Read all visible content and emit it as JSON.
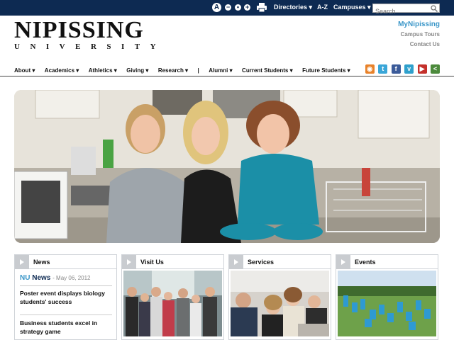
{
  "topbar": {
    "text_size_label": "A",
    "minus": "−",
    "dot": "•",
    "plus": "+",
    "nav": [
      "Directories ▾",
      "A-Z",
      "Campuses ▾"
    ],
    "search_placeholder": "Search"
  },
  "header": {
    "logo_main": "NIPISSING",
    "logo_sub": "UNIVERSITY",
    "right_links": {
      "primary": "MyNipissing",
      "secondary": [
        "Campus Tours",
        "Contact Us"
      ]
    }
  },
  "mainnav": {
    "items": [
      "About ▾",
      "Academics ▾",
      "Athletics ▾",
      "Giving ▾",
      "Research ▾",
      "|",
      "Alumni ▾",
      "Current Students ▾",
      "Future Students ▾"
    ]
  },
  "social": [
    {
      "icon": "rss-icon",
      "glyph": "◉",
      "color": "#e8822a"
    },
    {
      "icon": "twitter-icon",
      "glyph": "t",
      "color": "#3aa6d8"
    },
    {
      "icon": "facebook-icon",
      "glyph": "f",
      "color": "#3b5b99"
    },
    {
      "icon": "vimeo-icon",
      "glyph": "v",
      "color": "#2fa0cc"
    },
    {
      "icon": "youtube-icon",
      "glyph": "▶",
      "color": "#c4302b"
    },
    {
      "icon": "share-icon",
      "glyph": "<",
      "color": "#4c8a3c"
    }
  ],
  "boxes": {
    "news": {
      "title": "News",
      "brand_nu": "NU",
      "brand_news": "News",
      "date": "- May 06, 2012",
      "items": [
        "Poster event displays biology students' success",
        "Business students excel in strategy game"
      ]
    },
    "visit": {
      "title": "Visit Us"
    },
    "services": {
      "title": "Services"
    },
    "events": {
      "title": "Events"
    }
  }
}
